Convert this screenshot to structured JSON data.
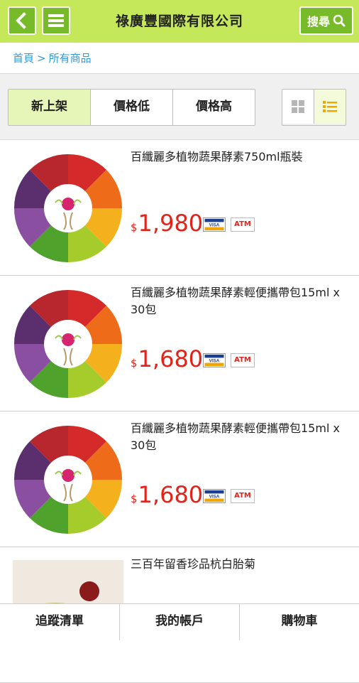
{
  "header": {
    "title": "祿廣豐國際有限公司",
    "search_label": "搜尋"
  },
  "breadcrumb": {
    "home": "首頁",
    "separator": ">",
    "current": "所有商品"
  },
  "sort": {
    "new": "新上架",
    "price_low": "價格低",
    "price_high": "價格高"
  },
  "products": [
    {
      "name": "百纖麗多植物蔬果酵素750ml瓶裝",
      "currency": "$",
      "price": "1,980",
      "visa": "VISA",
      "atm": "ATM"
    },
    {
      "name": "百纖麗多植物蔬果酵素輕便攜帶包15ml x 30包",
      "currency": "$",
      "price": "1,680",
      "visa": "VISA",
      "atm": "ATM"
    },
    {
      "name": "百纖麗多植物蔬果酵素輕便攜帶包15ml x 30包",
      "currency": "$",
      "price": "1,680",
      "visa": "VISA",
      "atm": "ATM"
    },
    {
      "name": "三百年留香珍品杭白胎菊"
    }
  ],
  "bottom_nav": {
    "wishlist": "追蹤清單",
    "account": "我的帳戶",
    "cart": "購物車"
  },
  "colors": {
    "header_bg": "#c5e85a",
    "button_green": "#77bb2a",
    "link_blue": "#2f9bd5",
    "price_red": "#e2231a"
  },
  "icons": [
    "back-icon",
    "menu-icon",
    "search-icon",
    "grid-view-icon",
    "list-view-icon"
  ]
}
